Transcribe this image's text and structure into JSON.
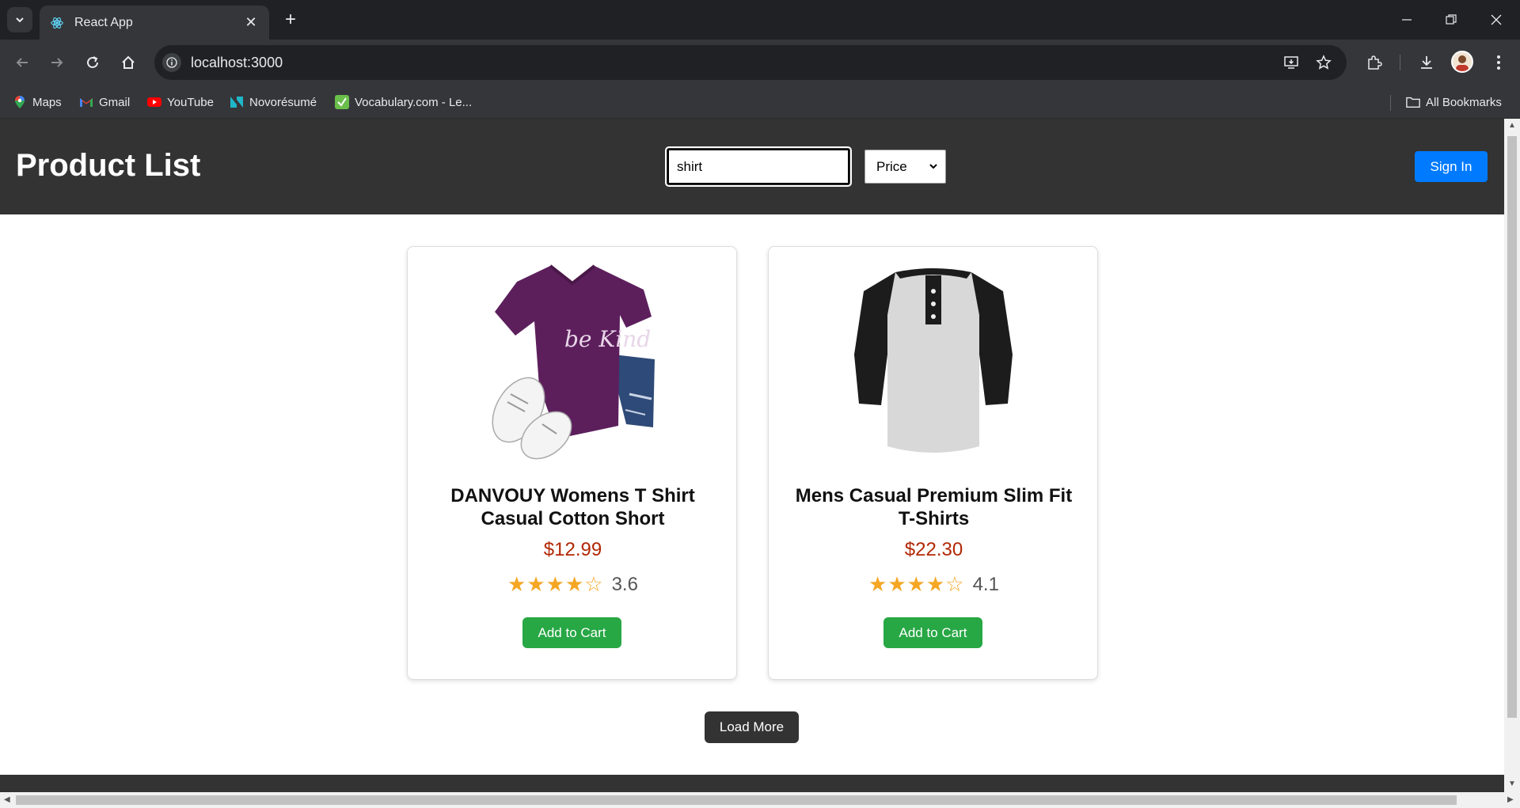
{
  "browser": {
    "tab_title": "React App",
    "url": "localhost:3000",
    "bookmarks": [
      {
        "label": "Maps",
        "icon": "maps-icon"
      },
      {
        "label": "Gmail",
        "icon": "gmail-icon"
      },
      {
        "label": "YouTube",
        "icon": "youtube-icon"
      },
      {
        "label": "Novorésumé",
        "icon": "novoresume-icon"
      },
      {
        "label": "Vocabulary.com - Le...",
        "icon": "vocabulary-icon"
      }
    ],
    "all_bookmarks_label": "All Bookmarks"
  },
  "header": {
    "title": "Product List",
    "search_value": "shirt",
    "sort_selected": "Price",
    "sign_in_label": "Sign In"
  },
  "products": [
    {
      "title": "DANVOUY Womens T Shirt Casual Cotton Short",
      "price": "$12.99",
      "stars": "★★★★☆",
      "rating": "3.6",
      "button_label": "Add to Cart",
      "image_text": "be Kind"
    },
    {
      "title": "Mens Casual Premium Slim Fit T-Shirts",
      "price": "$22.30",
      "stars": "★★★★☆",
      "rating": "4.1",
      "button_label": "Add to Cart"
    }
  ],
  "load_more_label": "Load More",
  "colors": {
    "header_bg": "#333333",
    "sign_in": "#007bff",
    "add_to_cart": "#28a745",
    "price": "#b12704",
    "stars": "#f5a623"
  }
}
